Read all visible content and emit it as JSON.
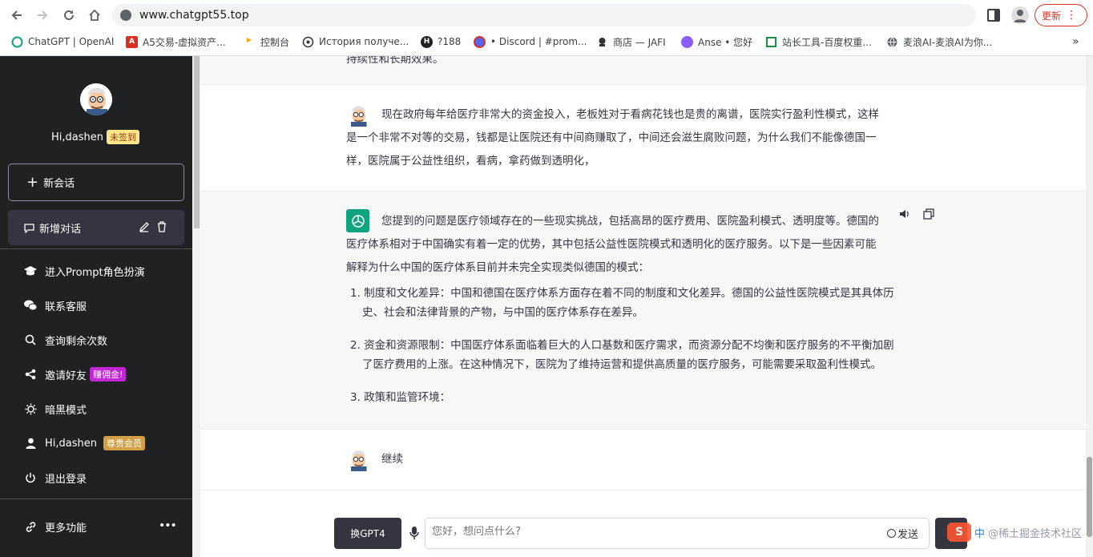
{
  "browser": {
    "url": "www.chatgpt55.top",
    "update_label": "更新",
    "bookmarks": [
      {
        "label": "ChatGPT | OpenAI",
        "icon": "openai-icon"
      },
      {
        "label": "A5交易-虚拟资产...",
        "icon": "a5-icon"
      },
      {
        "label": "控制台",
        "icon": "console-icon"
      },
      {
        "label": "История получе...",
        "icon": "history-icon"
      },
      {
        "label": "?188",
        "icon": "h-icon"
      },
      {
        "label": "• Discord | #prom...",
        "icon": "discord-icon"
      },
      {
        "label": "商店 — JAFI",
        "icon": "shop-icon"
      },
      {
        "label": "Anse • 您好",
        "icon": "anse-icon"
      },
      {
        "label": "站长工具-百度权重...",
        "icon": "webmaster-icon"
      },
      {
        "label": "麦浪AI-麦浪AI为你...",
        "icon": "globe-icon"
      }
    ],
    "more_label": "»"
  },
  "sidebar": {
    "greeting": "Hi,dashen",
    "signin_badge": "未签到",
    "new_chat_label": "新会话",
    "conversation_title": "新增对话",
    "menu": [
      {
        "label": "进入Prompt角色扮演",
        "icon": "graduation-cap-icon"
      },
      {
        "label": "联系客服",
        "icon": "wechat-icon"
      },
      {
        "label": "查询剩余次数",
        "icon": "search-icon"
      },
      {
        "label": "邀请好友",
        "icon": "share-icon",
        "badge": "赚佣金!"
      },
      {
        "label": "暗黑模式",
        "icon": "sun-icon"
      },
      {
        "label": "Hi,dashen",
        "icon": "user-icon",
        "badge": "尊贵会员"
      },
      {
        "label": "退出登录",
        "icon": "power-icon"
      }
    ],
    "more_label": "更多功能",
    "more_dots": "•••"
  },
  "chat": {
    "top_clip": "持续性和长期效果。",
    "user_message": [
      "现在政府每年给医疗非常大的资金投入，老板姓对于看病花钱也是贵的离谱，医院实行盈利性模式，这样",
      "是一个非常不对等的交易，钱都是让医院还有中间商赚取了，中间还会滋生腐败问题，为什么我们不能像德国一",
      "样，医院属于公益性组织，看病，拿药做到透明化，"
    ],
    "assistant_intro": [
      "您提到的问题是医疗领域存在的一些现实挑战，包括高昂的医疗费用、医院盈利模式、透明度等。德国的",
      "医疗体系相对于中国确实有着一定的优势，其中包括公益性医院模式和透明化的医疗服务。以下是一些因素可能",
      "解释为什么中国的医疗体系目前并未完全实现类似德国的模式："
    ],
    "list_items": [
      [
        "1. 制度和文化差异：中国和德国在医疗体系方面存在着不同的制度和文化差异。德国的公益性医院模式是其具体历",
        "史、社会和法律背景的产物，与中国的医疗体系存在差异。"
      ],
      [
        "2. 资金和资源限制：中国医疗体系面临着巨大的人口基数和医疗需求，而资源分配不均衡和医疗服务的不平衡加剧",
        "了医疗费用的上涨。在这种情况下，医院为了维持运营和提供高质量的医疗服务，可能需要采取盈利性模式。"
      ],
      [
        "3. 政策和监管环境："
      ]
    ],
    "continue_message": "继续"
  },
  "input": {
    "switch_label": "换GPT4",
    "placeholder": "您好，想问点什么?",
    "send_label": "发送"
  },
  "watermark": {
    "text": "@稀土掘金技术社区"
  }
}
